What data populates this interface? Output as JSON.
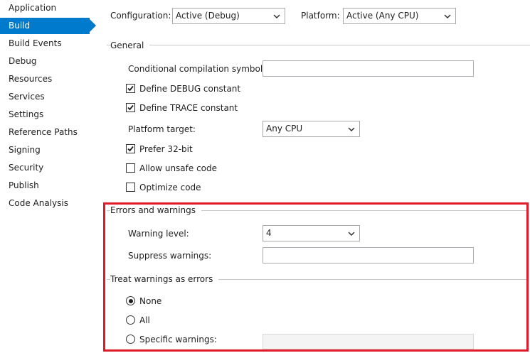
{
  "sidebar": {
    "items": [
      {
        "label": "Application"
      },
      {
        "label": "Build",
        "active": true
      },
      {
        "label": "Build Events"
      },
      {
        "label": "Debug"
      },
      {
        "label": "Resources"
      },
      {
        "label": "Services"
      },
      {
        "label": "Settings"
      },
      {
        "label": "Reference Paths"
      },
      {
        "label": "Signing"
      },
      {
        "label": "Security"
      },
      {
        "label": "Publish"
      },
      {
        "label": "Code Analysis"
      }
    ]
  },
  "header": {
    "configuration_label": "Configuration:",
    "configuration_value": "Active (Debug)",
    "platform_label": "Platform:",
    "platform_value": "Active (Any CPU)"
  },
  "general": {
    "title": "General",
    "conditional_symbols_label": "Conditional compilation symbols:",
    "conditional_symbols_value": "",
    "define_debug_label": "Define DEBUG constant",
    "define_debug_checked": true,
    "define_trace_label": "Define TRACE constant",
    "define_trace_checked": true,
    "platform_target_label": "Platform target:",
    "platform_target_value": "Any CPU",
    "prefer32_label": "Prefer 32-bit",
    "prefer32_checked": true,
    "allow_unsafe_label": "Allow unsafe code",
    "allow_unsafe_checked": false,
    "optimize_label": "Optimize code",
    "optimize_checked": false
  },
  "errors": {
    "title": "Errors and warnings",
    "warning_level_label": "Warning level:",
    "warning_level_value": "4",
    "suppress_label": "Suppress warnings:",
    "suppress_value": ""
  },
  "treat_warnings": {
    "title": "Treat warnings as errors",
    "selected": "None",
    "options": [
      {
        "label": "None"
      },
      {
        "label": "All"
      },
      {
        "label": "Specific warnings:"
      }
    ]
  },
  "colors": {
    "accent": "#007acc",
    "highlight": "#e01a2b"
  },
  "icons": {
    "dropdown": "chevron-down-icon",
    "check": "checkmark-icon",
    "radio": "radio-dot-icon"
  }
}
